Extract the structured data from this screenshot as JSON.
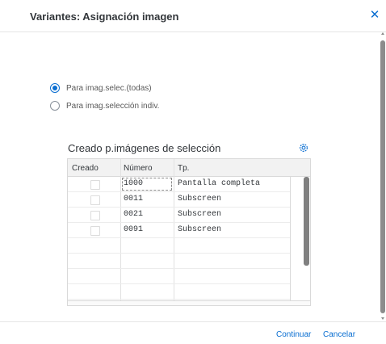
{
  "dialog": {
    "title": "Variantes: Asignación imagen",
    "close_icon": "close-icon"
  },
  "options": [
    {
      "label": "Para imag.selec.(todas)",
      "selected": true
    },
    {
      "label": "Para imag.selección indiv.",
      "selected": false
    }
  ],
  "table": {
    "title": "Creado p.imágenes de selección",
    "settings_icon": "gear-icon",
    "columns": [
      "Creado",
      "Número",
      "Tp."
    ],
    "rows": [
      {
        "creado": false,
        "numero": "1000",
        "tp": "Pantalla completa"
      },
      {
        "creado": false,
        "numero": "0011",
        "tp": "Subscreen"
      },
      {
        "creado": false,
        "numero": "0021",
        "tp": "Subscreen"
      },
      {
        "creado": false,
        "numero": "0091",
        "tp": "Subscreen"
      }
    ]
  },
  "footer": {
    "continue_label": "Continuar",
    "cancel_label": "Cancelar"
  },
  "colors": {
    "accent": "#0a6ed1",
    "text": "#32363a"
  }
}
